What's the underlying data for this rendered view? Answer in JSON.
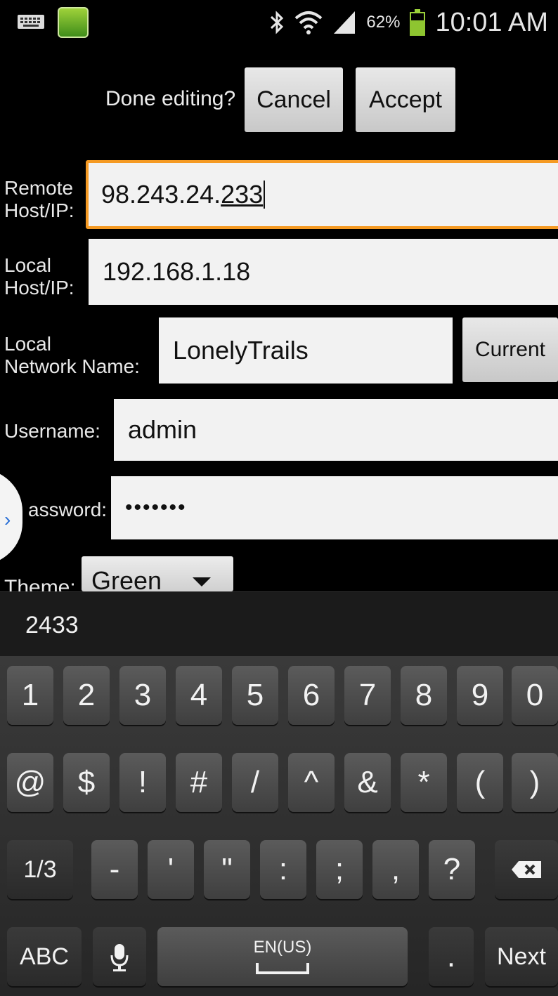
{
  "status_bar": {
    "battery_percent": "62%",
    "time": "10:01 AM",
    "icons": [
      "keyboard-icon",
      "app-notification-icon",
      "bluetooth-icon",
      "wifi-icon",
      "signal-icon",
      "battery-icon"
    ]
  },
  "edit_bar": {
    "prompt": "Done editing?",
    "cancel_label": "Cancel",
    "accept_label": "Accept"
  },
  "form": {
    "remote_host": {
      "label_line1": "Remote",
      "label_line2": "Host/IP:",
      "value_plain": "98.243.24.",
      "value_composing": "233"
    },
    "local_host": {
      "label_line1": "Local",
      "label_line2": "Host/IP:",
      "value": "192.168.1.18"
    },
    "network": {
      "label_line1": "Local",
      "label_line2": "Network Name:",
      "value": "LonelyTrails",
      "current_label": "Current"
    },
    "username": {
      "label": "Username:",
      "value": "admin"
    },
    "password": {
      "label": "assword:",
      "value": "•••••••"
    },
    "theme": {
      "label": "Theme:",
      "value": "Green"
    }
  },
  "keyboard": {
    "suggestion": "2433",
    "row1": [
      "1",
      "2",
      "3",
      "4",
      "5",
      "6",
      "7",
      "8",
      "9",
      "0"
    ],
    "row2": [
      "@",
      "$",
      "!",
      "#",
      "/",
      "^",
      "&",
      "*",
      "(",
      ")"
    ],
    "row3": [
      "1/3",
      "-",
      "'",
      "\"",
      ":",
      ";",
      ",",
      "?"
    ],
    "row4": {
      "abc": "ABC",
      "lang": "EN(US)",
      "period": ".",
      "next": "Next"
    }
  },
  "colors": {
    "focus": "#f59a23",
    "battery": "#8ec530",
    "background": "#000000"
  }
}
